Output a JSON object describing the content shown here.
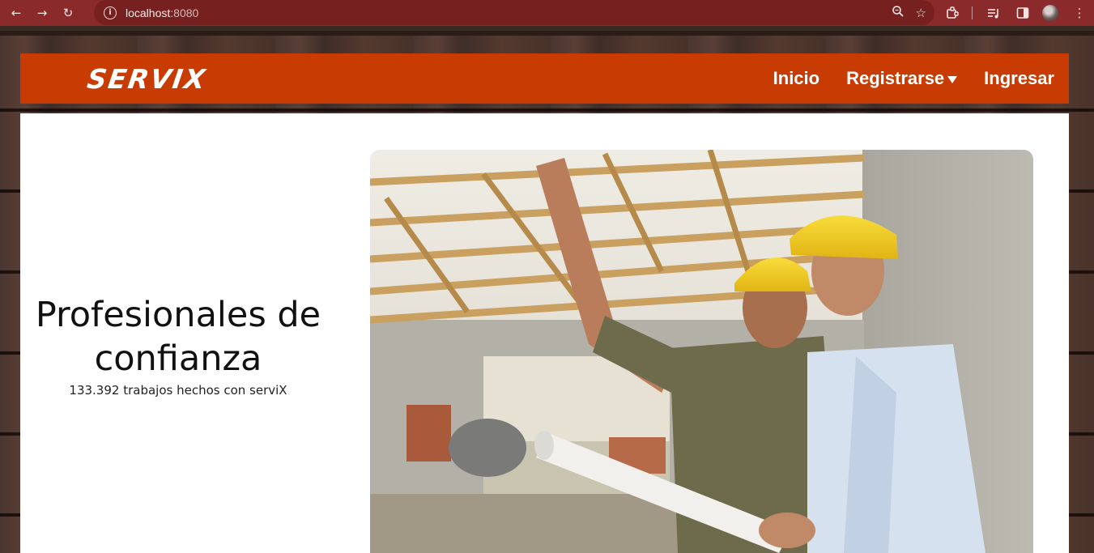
{
  "browser": {
    "url_host": "localhost",
    "url_port": ":8080"
  },
  "site": {
    "logo": "SERVIX",
    "menu": {
      "inicio": "Inicio",
      "registrarse": "Registrarse",
      "ingresar": "Ingresar"
    }
  },
  "hero": {
    "title_line1": "Profesionales de",
    "title_line2": "confianza",
    "subtitle": "133.392 trabajos hechos con serviX",
    "image_icon": "construction-workers-photo"
  },
  "colors": {
    "chrome": "#8b2a2a",
    "header": "#c83c03",
    "helmet": "#f2c81e"
  }
}
